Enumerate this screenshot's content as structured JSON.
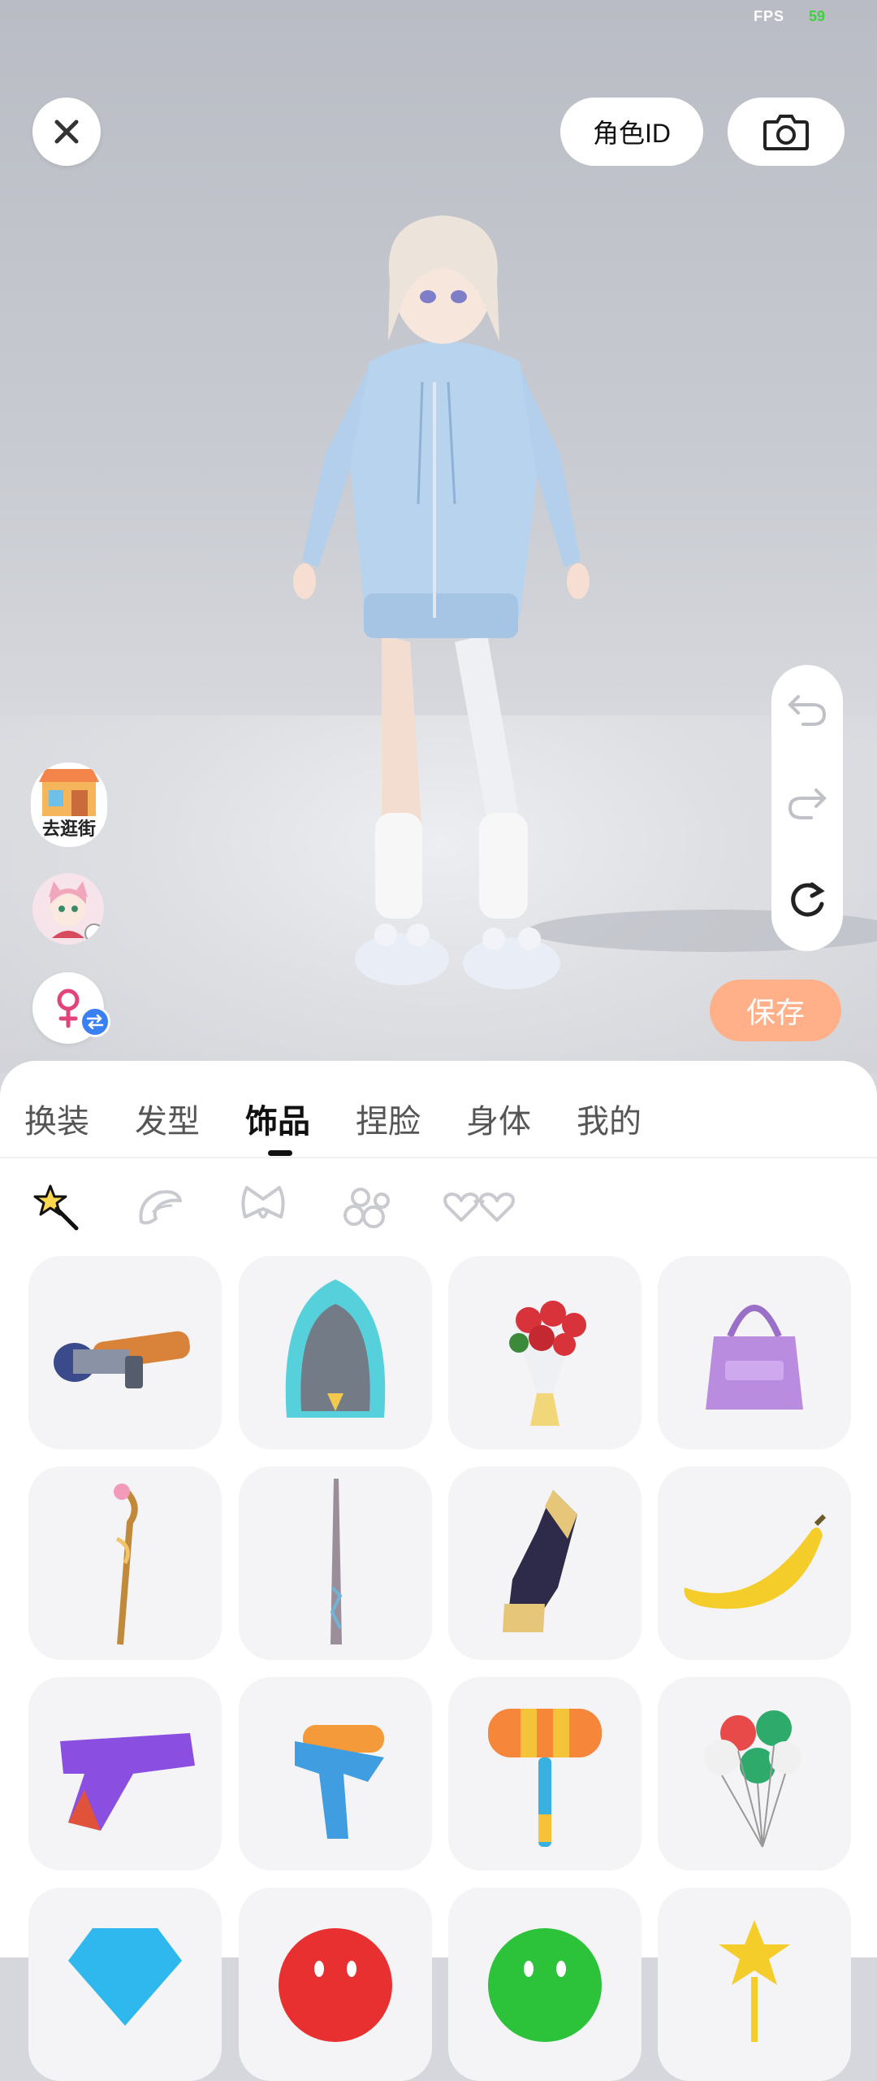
{
  "status": {
    "fps_label": "FPS",
    "fps_value": "59"
  },
  "header": {
    "role_id_label": "角色ID"
  },
  "left_tools": {
    "street_label": "去逛街"
  },
  "actions": {
    "save_label": "保存"
  },
  "tabs": [
    {
      "label": "换装"
    },
    {
      "label": "发型"
    },
    {
      "label": "饰品",
      "active": true
    },
    {
      "label": "捏脸"
    },
    {
      "label": "身体"
    },
    {
      "label": "我的"
    }
  ],
  "subcategories": [
    {
      "icon": "magic-wand-icon",
      "active": true
    },
    {
      "icon": "wing-icon"
    },
    {
      "icon": "bow-icon"
    },
    {
      "icon": "flower-icon"
    },
    {
      "icon": "heart-glasses-icon"
    }
  ],
  "items": [
    {
      "name": "rocket-launcher"
    },
    {
      "name": "iron"
    },
    {
      "name": "rose-bouquet"
    },
    {
      "name": "purple-handbag"
    },
    {
      "name": "magic-staff"
    },
    {
      "name": "wand"
    },
    {
      "name": "armored-boot"
    },
    {
      "name": "banana"
    },
    {
      "name": "purple-blaster"
    },
    {
      "name": "water-gun"
    },
    {
      "name": "toy-hammer"
    },
    {
      "name": "balloons"
    },
    {
      "name": "blue-gem"
    },
    {
      "name": "red-smiley"
    },
    {
      "name": "green-face"
    },
    {
      "name": "star-wand"
    }
  ],
  "colors": {
    "accent": "#ffb089",
    "gender": "#e0447a",
    "swap_badge": "#3b7ff5"
  }
}
